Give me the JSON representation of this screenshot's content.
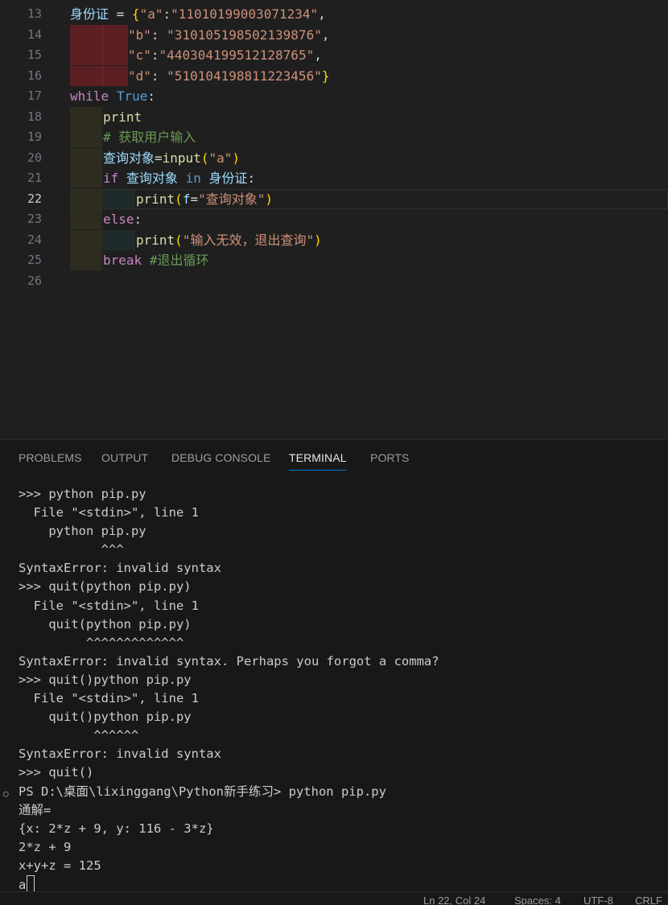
{
  "editor": {
    "line_numbers": [
      "13",
      "14",
      "15",
      "16",
      "17",
      "18",
      "19",
      "20",
      "21",
      "22",
      "23",
      "24",
      "25",
      "26"
    ],
    "line13": {
      "var": "身份证",
      "eq": " = ",
      "brace_open": "{",
      "k1": "\"a\"",
      "colon1": ":",
      "v1": "\"11010199003071234\"",
      "comma": ","
    },
    "line14": {
      "key": "\"b\"",
      "colon": ": ",
      "val": "\"310105198502139876\"",
      "comma": ","
    },
    "line15": {
      "key": "\"c\"",
      "colon": ":",
      "val": "\"440304199512128765\"",
      "comma": ","
    },
    "line16": {
      "key": "\"d\"",
      "colon": ": ",
      "val": "\"510104198811223456\"",
      "brace_close": "}"
    },
    "line17": {
      "kw": "while",
      "sp": " ",
      "const": "True",
      "colon": ":"
    },
    "line18": {
      "fn": "print"
    },
    "line19": {
      "comment": "# 获取用户输入"
    },
    "line20": {
      "var": "查询对象",
      "eq": "=",
      "fn": "input",
      "po": "(",
      "arg": "\"a\"",
      "pc": ")"
    },
    "line21": {
      "kw": "if",
      "sp1": " ",
      "var": "查询对象",
      "sp2": " ",
      "op": "in",
      "sp3": " ",
      "var2": "身份证",
      "colon": ":"
    },
    "line22": {
      "fn": "print",
      "po": "(",
      "prefix": "f",
      "eq": "=",
      "arg": "\"查询对象\"",
      "pc": ")"
    },
    "line23": {
      "kw": "else",
      "colon": ":"
    },
    "line24": {
      "fn": "print",
      "po": "(",
      "arg": "\"输入无效，退出查询\"",
      "pc": ")"
    },
    "line25": {
      "kw": "break",
      "sp": " ",
      "comment": "#退出循环"
    }
  },
  "panel": {
    "tabs": [
      "PROBLEMS",
      "OUTPUT",
      "DEBUG CONSOLE",
      "TERMINAL",
      "PORTS"
    ],
    "active_tab": "TERMINAL"
  },
  "terminal": {
    "lines": [
      ">>> python pip.py",
      "  File \"<stdin>\", line 1",
      "    python pip.py",
      "           ^^^",
      "SyntaxError: invalid syntax",
      ">>> quit(python pip.py)",
      "  File \"<stdin>\", line 1",
      "    quit(python pip.py)",
      "         ^^^^^^^^^^^^^",
      "SyntaxError: invalid syntax. Perhaps you forgot a comma?",
      ">>> quit()python pip.py",
      "  File \"<stdin>\", line 1",
      "    quit()python pip.py",
      "          ^^^^^^",
      "SyntaxError: invalid syntax",
      ">>> quit()",
      "PS D:\\桌面\\lixinggang\\Python新手练习> python pip.py",
      "通解=",
      "{x: 2*z + 9, y: 116 - 3*z}",
      "2*z + 9",
      "x+y+z = 125"
    ],
    "input_line": "a",
    "prompt_marker": "○"
  },
  "status_bar": {
    "position": "Ln 22, Col 24",
    "spaces": "Spaces: 4",
    "encoding": "UTF-8",
    "eol": "CRLF"
  }
}
